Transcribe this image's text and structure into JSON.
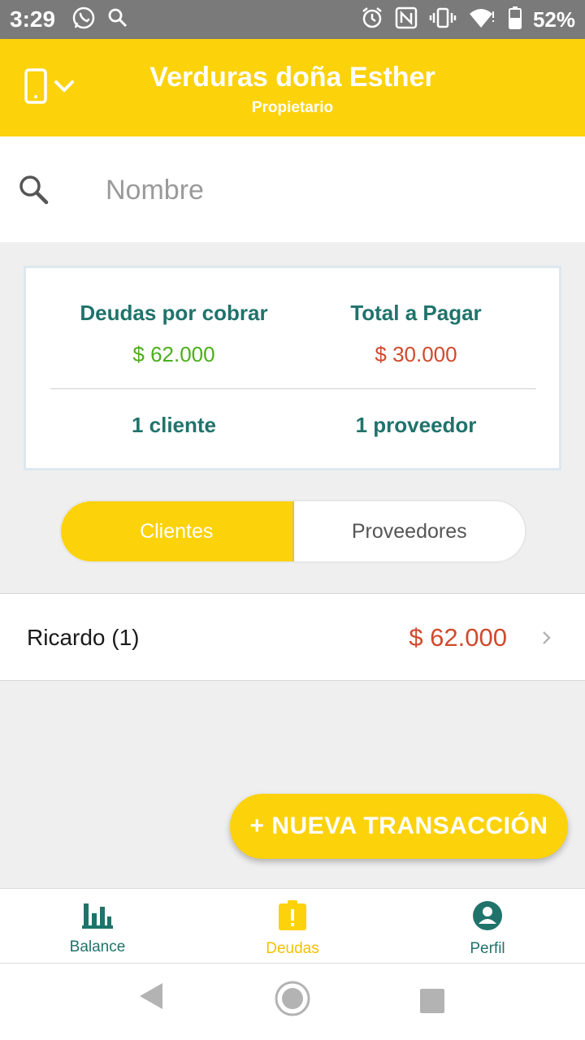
{
  "status_bar": {
    "time": "3:29",
    "battery": "52%",
    "icons_left": [
      "whatsapp-icon",
      "search-icon"
    ],
    "icons_right": [
      "alarm-icon",
      "nfc-icon",
      "vibrate-icon",
      "wifi-icon",
      "battery-icon"
    ]
  },
  "header": {
    "title": "Verduras doña Esther",
    "subtitle": "Propietario",
    "color": "#fcd20a"
  },
  "search": {
    "placeholder": "Nombre",
    "value": ""
  },
  "summary": {
    "receivable_label": "Deudas por cobrar",
    "receivable_amount": "$ 62.000",
    "payable_label": "Total a Pagar",
    "payable_amount": "$ 30.000",
    "clients_count": "1 cliente",
    "providers_count": "1 proveedor"
  },
  "tabs": {
    "clients": "Clientes",
    "providers": "Proveedores",
    "active": "clients"
  },
  "list": [
    {
      "name": "Ricardo (1)",
      "amount": "$ 62.000"
    }
  ],
  "fab": {
    "label": "+ NUEVA TRANSACCIÓN"
  },
  "bottom_nav": {
    "balance": "Balance",
    "debts": "Deudas",
    "profile": "Perfil",
    "active": "debts"
  },
  "colors": {
    "accent": "#fcd20a",
    "teal": "#20736b",
    "green": "#4caf1a",
    "red": "#d04a2d"
  }
}
